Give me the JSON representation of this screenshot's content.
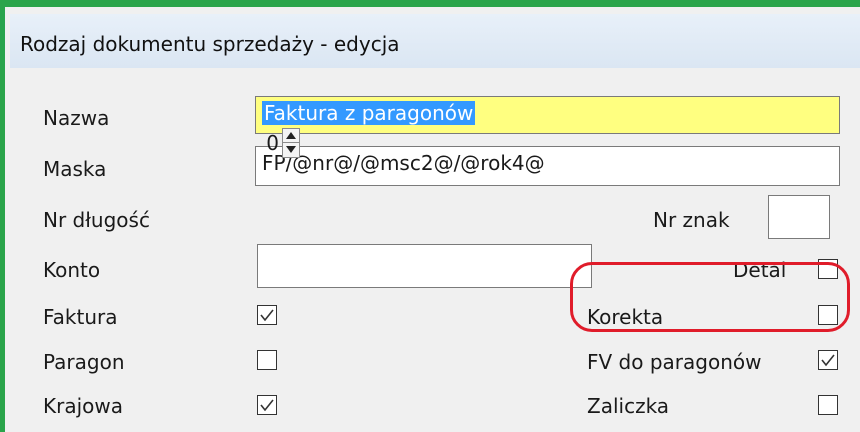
{
  "window": {
    "title": "Rodzaj dokumentu sprzedaży - edycja"
  },
  "fields": {
    "nazwa": {
      "label": "Nazwa",
      "value": "Faktura z paragonów"
    },
    "maska": {
      "label": "Maska",
      "value": "FP/@nr@/@msc2@/@rok4@"
    },
    "nr_dlugosc": {
      "label": "Nr długość",
      "value": "0"
    },
    "nr_znak": {
      "label": "Nr znak",
      "value": ""
    },
    "konto": {
      "label": "Konto",
      "value": ""
    }
  },
  "checkboxes": {
    "detal": {
      "label": "Detal",
      "checked": false
    },
    "faktura": {
      "label": "Faktura",
      "checked": true
    },
    "korekta": {
      "label": "Korekta",
      "checked": false
    },
    "paragon": {
      "label": "Paragon",
      "checked": false
    },
    "fv_do_paragonow": {
      "label": "FV do paragonów",
      "checked": true
    },
    "krajowa": {
      "label": "Krajowa",
      "checked": true
    },
    "zaliczka": {
      "label": "Zaliczka",
      "checked": false
    }
  },
  "colors": {
    "window_border": "#2aa44a",
    "required_field": "#ffff80",
    "selection": "#3399ff",
    "annotation": "#e01c2a"
  }
}
